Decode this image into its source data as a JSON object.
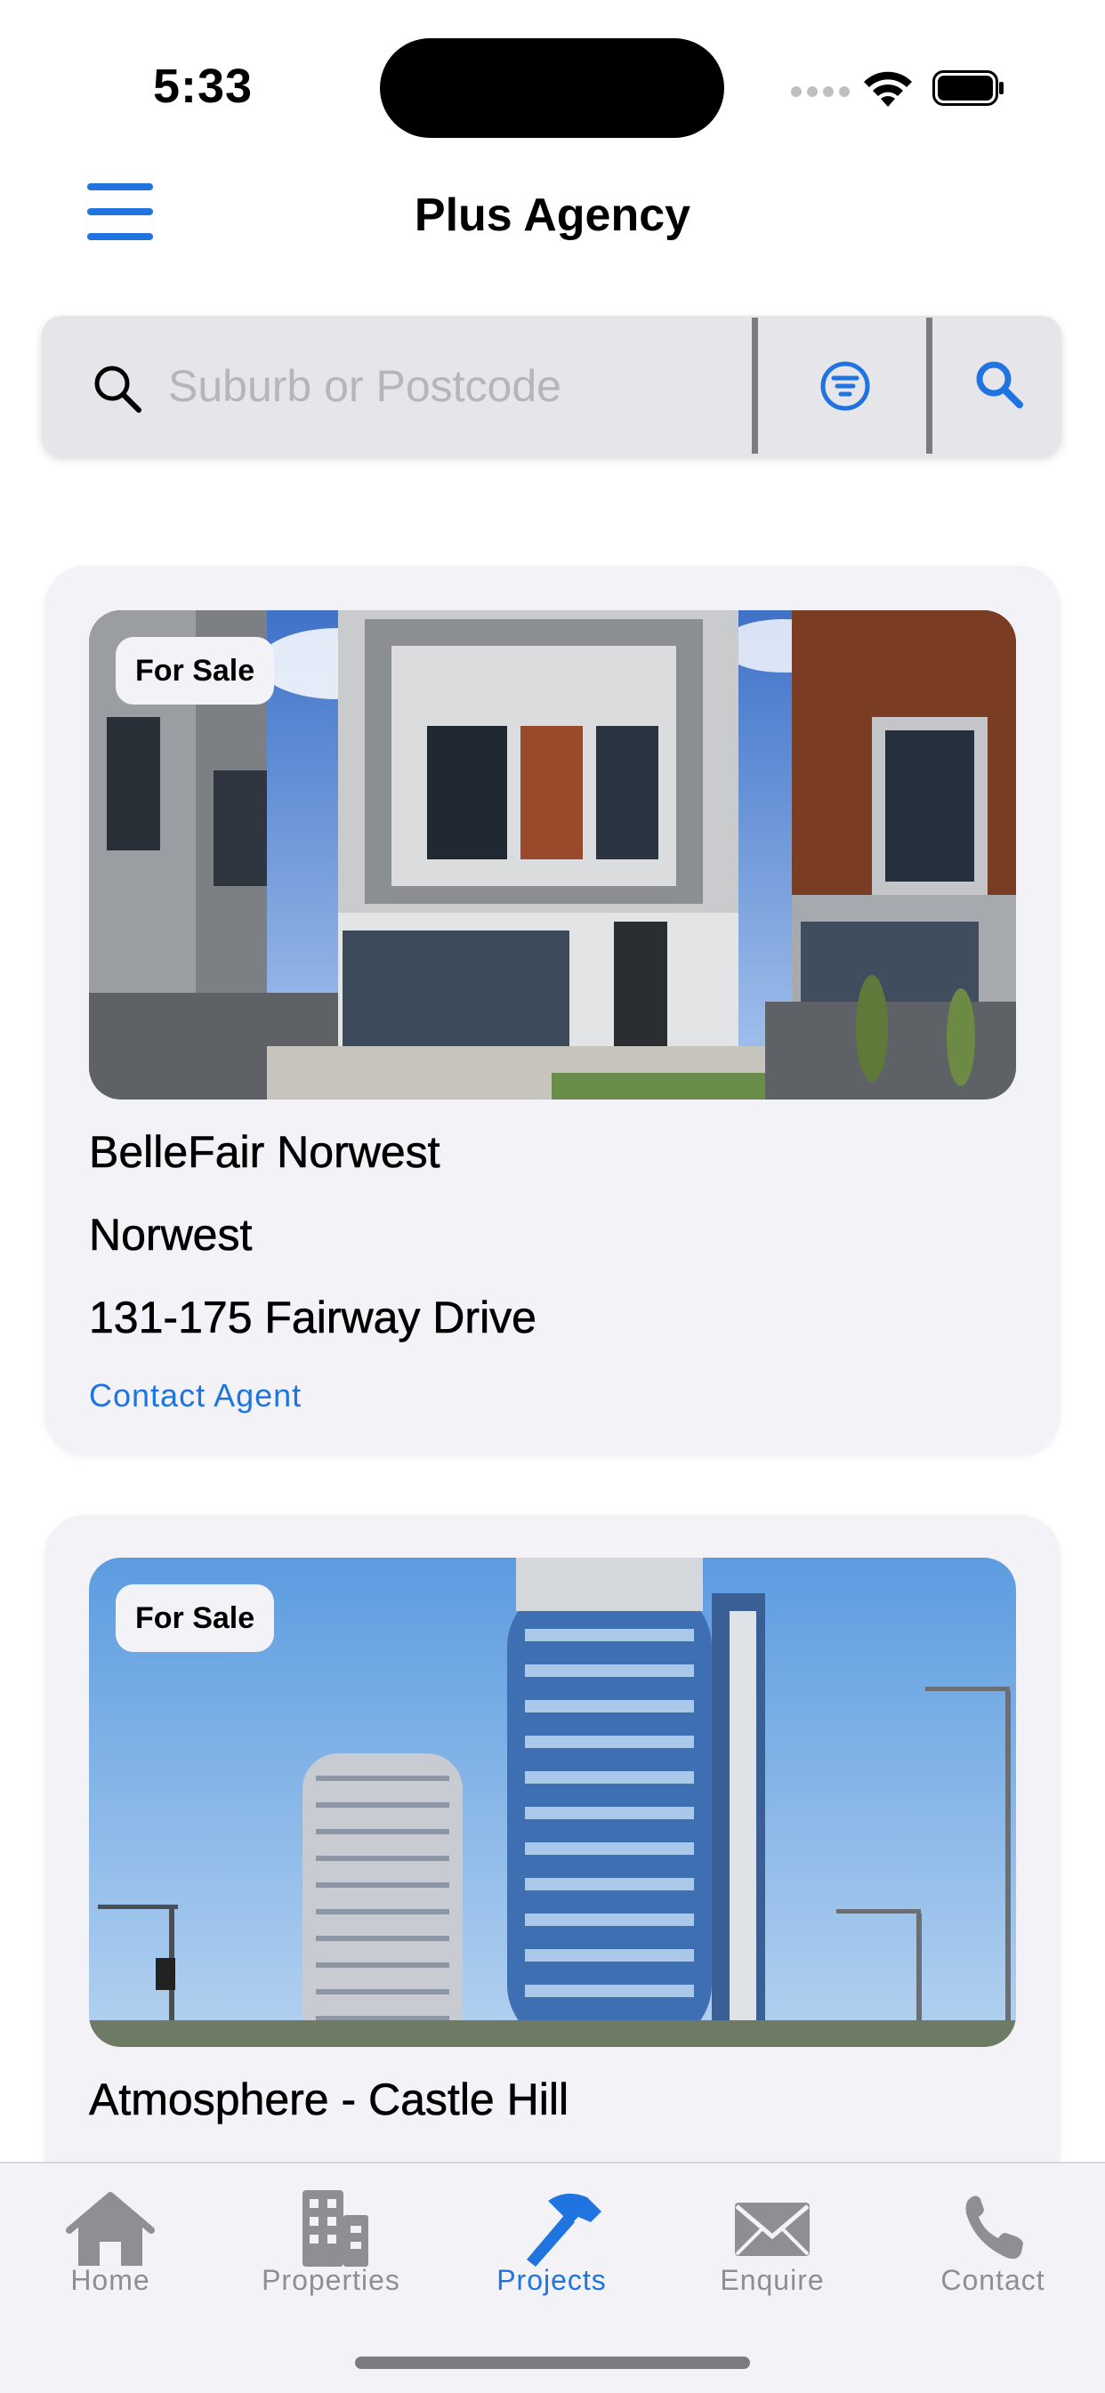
{
  "status": {
    "time": "5:33"
  },
  "header": {
    "title": "Plus Agency"
  },
  "search": {
    "placeholder": "Suburb or Postcode",
    "value": ""
  },
  "listings": [
    {
      "badge": "For Sale",
      "name": "BelleFair Norwest",
      "suburb": "Norwest",
      "address": "131-175 Fairway Drive",
      "contact": "Contact Agent"
    },
    {
      "badge": "For Sale",
      "name": "Atmosphere - Castle Hill"
    }
  ],
  "tabs": [
    {
      "label": "Home",
      "icon": "house-icon",
      "active": false
    },
    {
      "label": "Properties",
      "icon": "building-icon",
      "active": false
    },
    {
      "label": "Projects",
      "icon": "hammer-icon",
      "active": true
    },
    {
      "label": "Enquire",
      "icon": "envelope-icon",
      "active": false
    },
    {
      "label": "Contact",
      "icon": "phone-icon",
      "active": false
    }
  ],
  "colors": {
    "accent": "#1f74e0",
    "card_bg": "#f2f2f7",
    "search_bg": "#e5e5ea",
    "inactive_tab": "#8e8e93"
  }
}
